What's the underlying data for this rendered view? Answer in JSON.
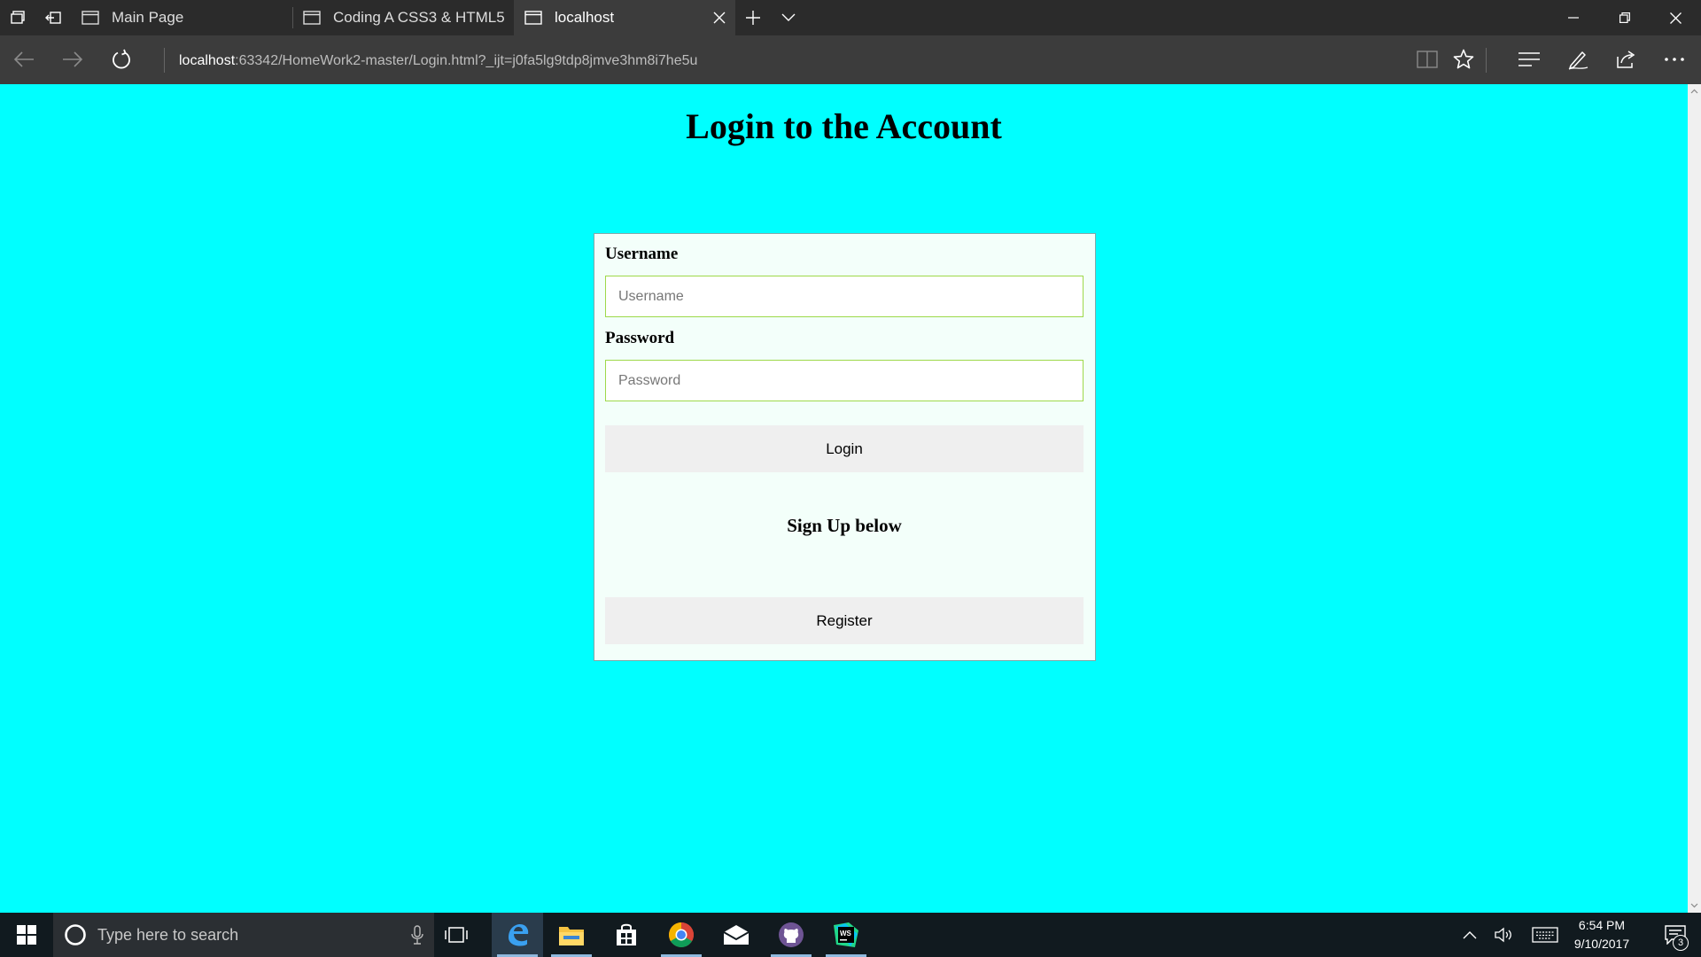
{
  "browser": {
    "tabs": [
      {
        "label": "Main Page",
        "active": false
      },
      {
        "label": "Coding A CSS3 & HTML5",
        "active": false
      },
      {
        "label": "localhost",
        "active": true
      }
    ],
    "address": {
      "host": "localhost",
      "rest": ":63342/HomeWork2-master/Login.html?_ijt=j0fa5lg9tdp8jmve3hm8i7he5u"
    }
  },
  "page": {
    "title": "Login to the Account",
    "background": "#00ffff",
    "form": {
      "username_label": "Username",
      "username_placeholder": "Username",
      "password_label": "Password",
      "password_placeholder": "Password",
      "login_button": "Login",
      "signup_text": "Sign Up below",
      "register_button": "Register"
    }
  },
  "taskbar": {
    "search_placeholder": "Type here to search",
    "apps": [
      "edge-icon",
      "file-explorer-icon",
      "store-icon",
      "chrome-icon",
      "mail-icon",
      "github-icon",
      "webstorm-icon"
    ],
    "active_app": "edge-icon",
    "time": "6:54 PM",
    "date": "9/10/2017",
    "notification_count": "3"
  }
}
